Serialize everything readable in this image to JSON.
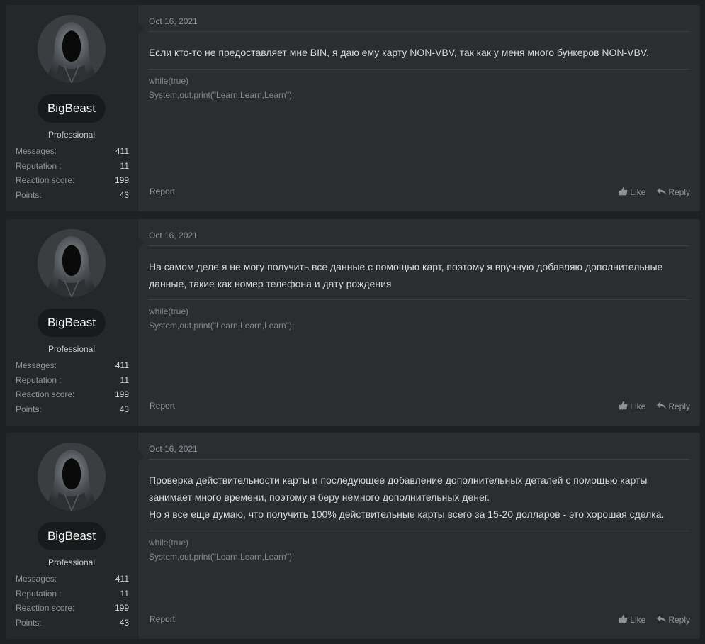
{
  "posts": [
    {
      "username": "BigBeast",
      "rank": "Professional",
      "stats": [
        {
          "label": "Messages:",
          "value": "411"
        },
        {
          "label": "Reputation :",
          "value": "11"
        },
        {
          "label": "Reaction score:",
          "value": "199"
        },
        {
          "label": "Points:",
          "value": "43"
        }
      ],
      "date": "Oct 16, 2021",
      "body": "Если кто-то не предоставляет мне BIN, я даю ему карту NON-VBV, так как у меня много бункеров NON-VBV.",
      "signature": [
        "while(true)",
        "System,out.print(\"Learn,Learn,Learn\");"
      ],
      "report_label": "Report",
      "like_label": "Like",
      "reply_label": "Reply"
    },
    {
      "username": "BigBeast",
      "rank": "Professional",
      "stats": [
        {
          "label": "Messages:",
          "value": "411"
        },
        {
          "label": "Reputation :",
          "value": "11"
        },
        {
          "label": "Reaction score:",
          "value": "199"
        },
        {
          "label": "Points:",
          "value": "43"
        }
      ],
      "date": "Oct 16, 2021",
      "body": "На самом деле я не могу получить все данные с помощью карт, поэтому я вручную добавляю дополнительные\nданные, такие как номер телефона и дату рождения",
      "signature": [
        "while(true)",
        "System,out.print(\"Learn,Learn,Learn\");"
      ],
      "report_label": "Report",
      "like_label": "Like",
      "reply_label": "Reply"
    },
    {
      "username": "BigBeast",
      "rank": "Professional",
      "stats": [
        {
          "label": "Messages:",
          "value": "411"
        },
        {
          "label": "Reputation :",
          "value": "11"
        },
        {
          "label": "Reaction score:",
          "value": "199"
        },
        {
          "label": "Points:",
          "value": "43"
        }
      ],
      "date": "Oct 16, 2021",
      "body": "Проверка действительности карты и последующее добавление дополнительных деталей с помощью карты\nзанимает много времени, поэтому я беру немного дополнительных денег.\nНо я все еще думаю, что получить 100% действительные карты всего за 15-20 долларов - это хорошая сделка.",
      "signature": [
        "while(true)",
        "System,out.print(\"Learn,Learn,Learn\");"
      ],
      "report_label": "Report",
      "like_label": "Like",
      "reply_label": "Reply"
    }
  ]
}
